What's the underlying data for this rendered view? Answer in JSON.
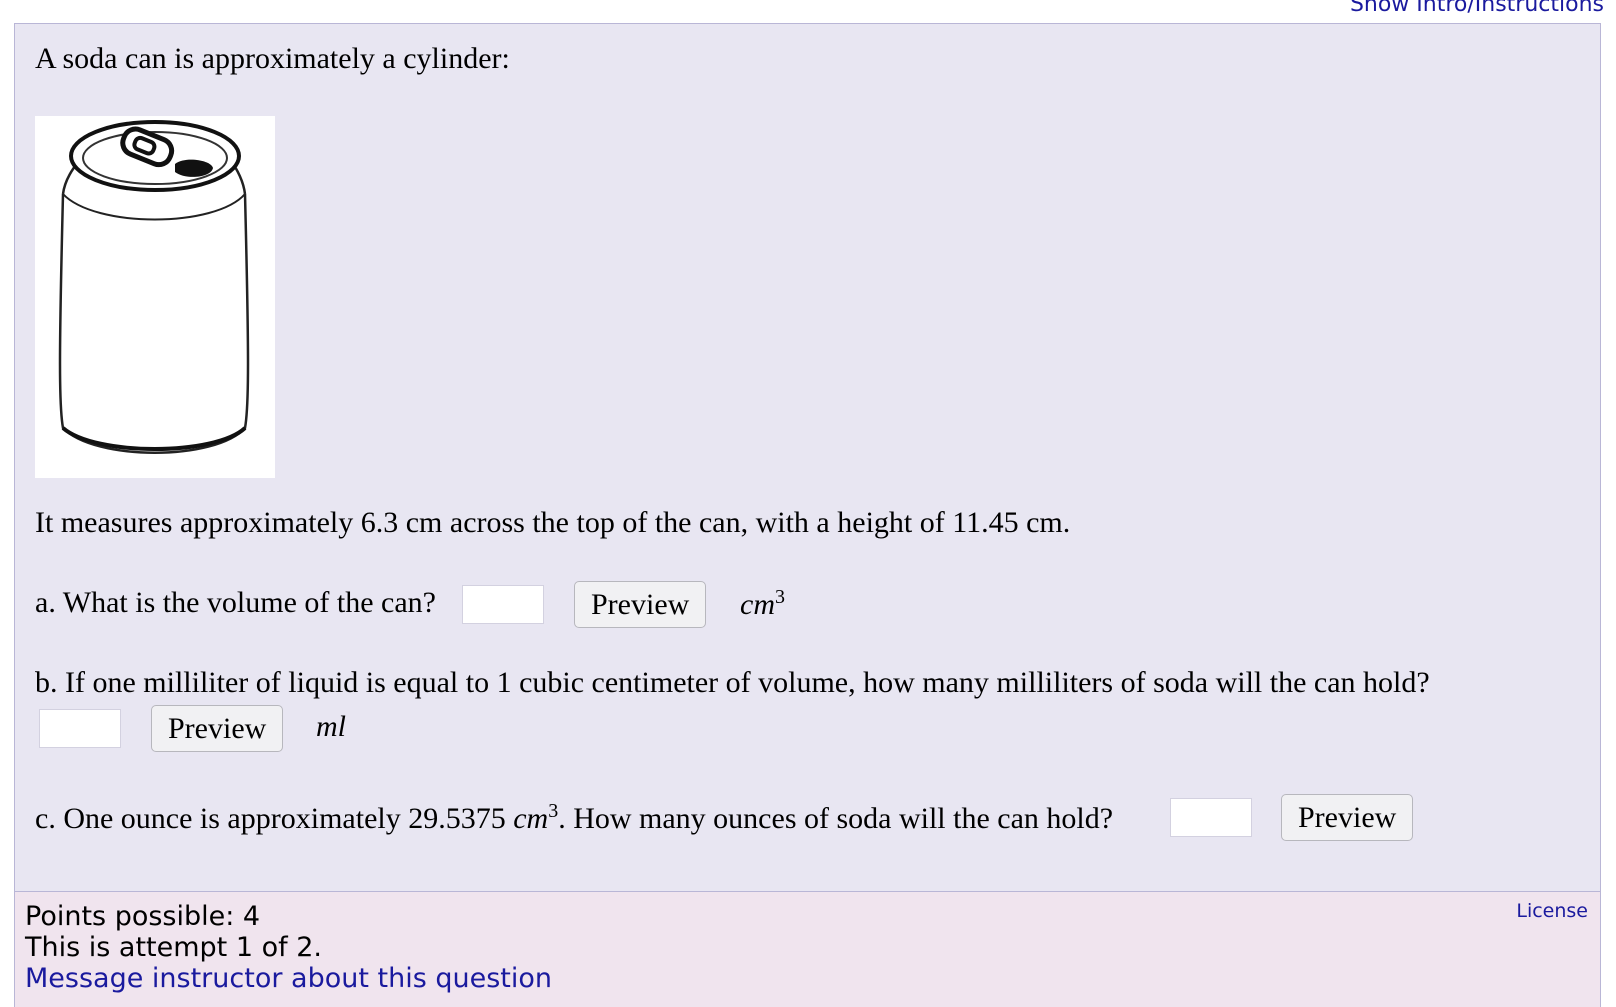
{
  "header": {
    "intro_link": "Show Intro/Instructions"
  },
  "question": {
    "intro": "A soda can is approximately a cylinder:",
    "image": "soda-can-drawing",
    "measures": "It measures approximately 6.3 cm across the top of the can, with a height of 11.45 cm.",
    "part_a": {
      "prompt": "a. What is the volume of the can?",
      "input_value": "",
      "preview_label": "Preview",
      "unit": "cm",
      "unit_exp": "3"
    },
    "part_b": {
      "prompt": "b. If one milliliter of liquid is equal to 1 cubic centimeter of volume, how many milliliters of soda will the can hold?",
      "input_value": "",
      "preview_label": "Preview",
      "unit": "ml"
    },
    "part_c": {
      "prompt_before": "c. One ounce is approximately 29.5375 ",
      "prompt_unit": "cm",
      "prompt_exp": "3",
      "prompt_after": ". How many ounces of soda will the can hold?",
      "input_value": "",
      "preview_label": "Preview"
    }
  },
  "footer": {
    "points": "Points possible: 4",
    "attempt": "This is attempt 1 of 2.",
    "message_link": "Message instructor about this question",
    "license_link": "License"
  },
  "colors": {
    "question_bg": "#e8e6f2",
    "footer_bg": "#f0e4ee",
    "link": "#1a1a9e"
  }
}
